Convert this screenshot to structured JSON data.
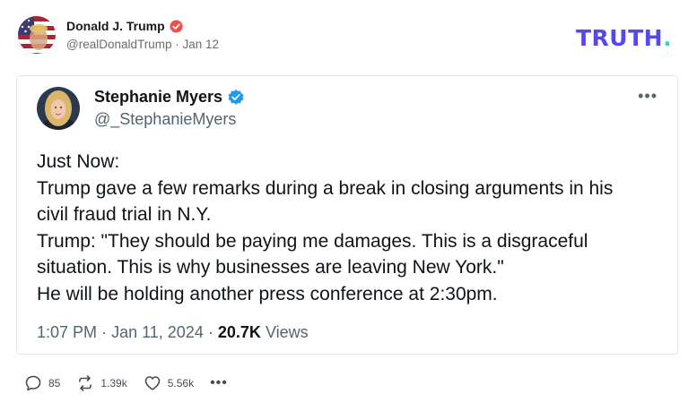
{
  "post": {
    "author_name": "Donald J. Trump",
    "handle": "@realDonaldTrump",
    "separator": "·",
    "date": "Jan 12"
  },
  "brand": {
    "logo_text": "TRUTH",
    "logo_dot": ".",
    "logo_color": "#5448ee",
    "dot_color": "#3ed6b6"
  },
  "tweet": {
    "author_name": "Stephanie Myers",
    "handle": "@_StephanieMyers",
    "more_label": "•••",
    "lines": [
      "Just Now:",
      "Trump gave a few remarks during a break in closing arguments in his",
      "civil fraud trial in N.Y.",
      "Trump: \"They should be paying me damages. This is a disgraceful",
      "situation. This is why businesses are leaving New York.\"",
      "He will be holding another press conference at 2:30pm."
    ],
    "time": "1:07 PM",
    "date": "Jan 11, 2024",
    "separator": "·",
    "views_count": "20.7K",
    "views_label": "Views"
  },
  "actions": {
    "replies": "85",
    "retruths": "1.39k",
    "likes": "5.56k",
    "more_label": "•••"
  }
}
